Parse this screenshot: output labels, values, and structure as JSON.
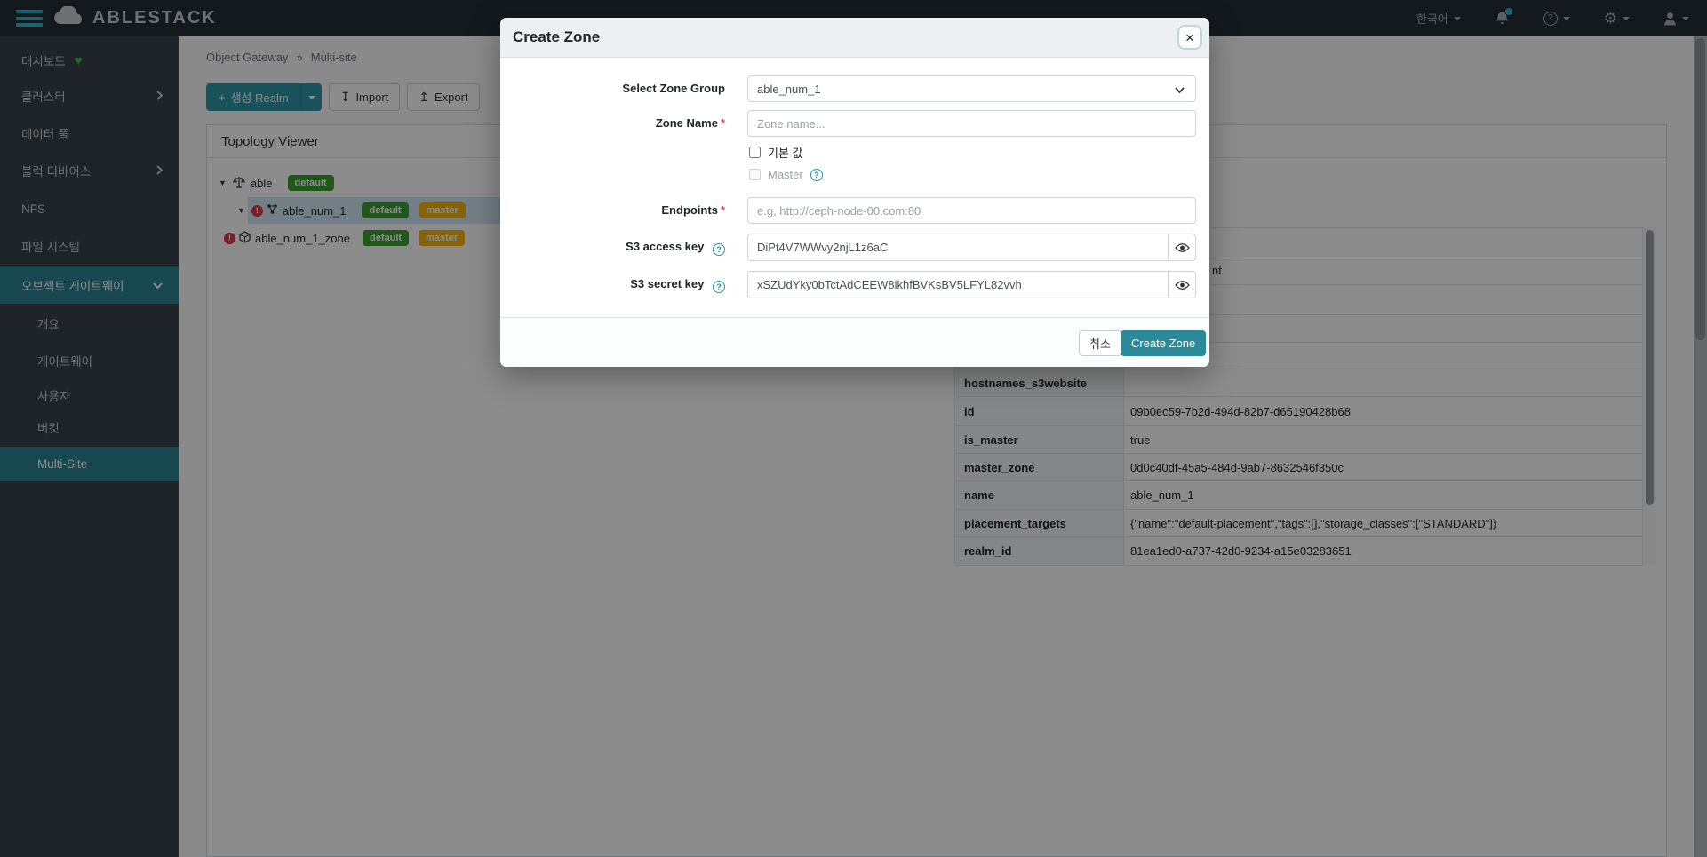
{
  "colors": {
    "accent_teal": "#2f96a5",
    "active_teal": "#2a8291",
    "badge_green": "#3e9e33",
    "badge_orange": "#f5b50f",
    "danger_red": "#dc3545",
    "selected_row": "#cfe7f4"
  },
  "icons": {
    "plus": "+",
    "caret_tree": "▼",
    "breadcrumb_sep": "»",
    "import": "↧",
    "export": "↥",
    "gear": "⚙",
    "heart": "♥",
    "close": "×",
    "question": "?",
    "exclamation": "!"
  },
  "navbar": {
    "brand": "ABLESTACK",
    "language": "한국어"
  },
  "sidebar": {
    "items": [
      {
        "label": "대시보드"
      },
      {
        "label": "클러스터"
      },
      {
        "label": "데이터 풀"
      },
      {
        "label": "블럭 디바이스"
      },
      {
        "label": "NFS"
      },
      {
        "label": "파일 시스템"
      },
      {
        "label": "오브젝트 게이트웨이"
      }
    ],
    "subitems": [
      {
        "label": "개요"
      },
      {
        "label": "게이트웨이"
      },
      {
        "label": "사용자"
      },
      {
        "label": "버킷"
      },
      {
        "label": "Multi-Site"
      }
    ]
  },
  "breadcrumb": {
    "section": "Object Gateway",
    "page": "Multi-site"
  },
  "toolbar": {
    "create_label": "생성 Realm",
    "import_label": "Import",
    "export_label": "Export"
  },
  "topology": {
    "title": "Topology Viewer",
    "nodes": [
      {
        "name": "able",
        "badges": [
          "default"
        ]
      },
      {
        "name": "able_num_1",
        "badges": [
          "default",
          "master"
        ]
      },
      {
        "name": "able_num_1_zone",
        "badges": [
          "default",
          "master"
        ]
      }
    ]
  },
  "details": {
    "covered_fragment": "nt",
    "rows": [
      {
        "key": "hostnames_s3website",
        "value": ""
      },
      {
        "key": "id",
        "value": "09b0ec59-7b2d-494d-82b7-d65190428b68"
      },
      {
        "key": "is_master",
        "value": "true"
      },
      {
        "key": "master_zone",
        "value": "0d0c40df-45a5-484d-9ab7-8632546f350c"
      },
      {
        "key": "name",
        "value": "able_num_1"
      },
      {
        "key": "placement_targets",
        "value": "{\"name\":\"default-placement\",\"tags\":[],\"storage_classes\":[\"STANDARD\"]}"
      },
      {
        "key": "realm_id",
        "value": "81ea1ed0-a737-42d0-9234-a15e03283651"
      }
    ]
  },
  "modal": {
    "title": "Create Zone",
    "select_zone_group": {
      "label": "Select Zone Group",
      "value": "able_num_1"
    },
    "zone_name": {
      "label": "Zone Name",
      "placeholder": "Zone name..."
    },
    "default_checkbox": {
      "label": "기본 값"
    },
    "master_checkbox": {
      "label": "Master"
    },
    "endpoints": {
      "label": "Endpoints",
      "placeholder": "e.g, http://ceph-node-00.com:80"
    },
    "s3_access_key": {
      "label": "S3 access key",
      "value": "DiPt4V7WWvy2njL1z6aC"
    },
    "s3_secret_key": {
      "label": "S3 secret key",
      "value": "xSZUdYky0bTctAdCEEW8ikhfBVKsBV5LFYL82vvh"
    },
    "footer": {
      "cancel_label": "취소",
      "submit_label": "Create Zone"
    }
  }
}
